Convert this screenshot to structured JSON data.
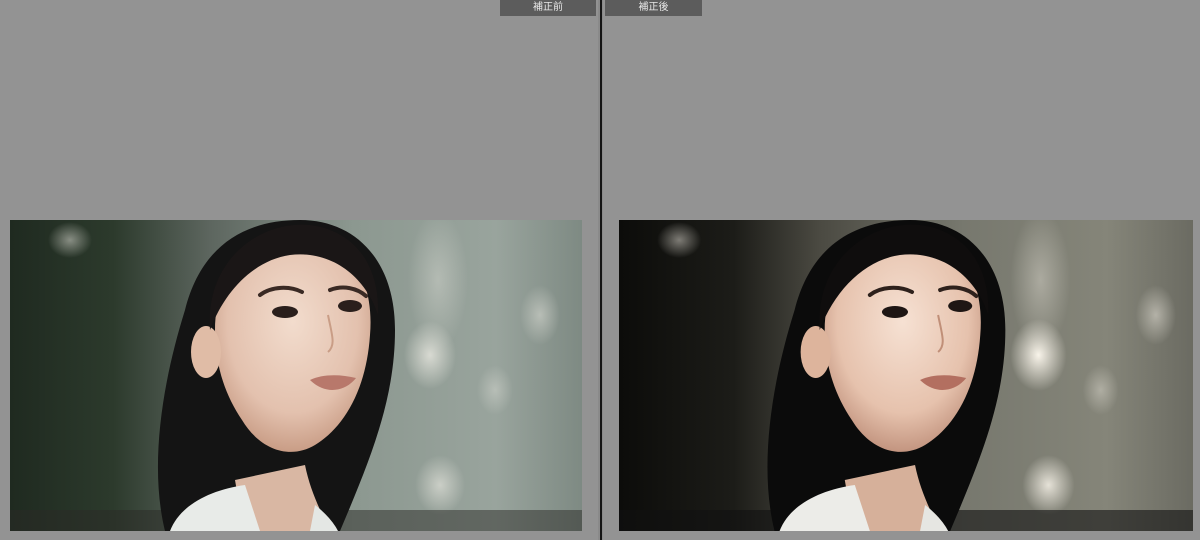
{
  "viewer": {
    "before_label": "補正前",
    "after_label": "補正後"
  },
  "photos": {
    "before": {
      "subject": "portrait-woman",
      "tone": "original"
    },
    "after": {
      "subject": "portrait-woman",
      "tone": "corrected"
    }
  },
  "colors": {
    "background": "#929292",
    "label_bg": "#5c5c5c",
    "label_text": "#e8e8e8",
    "divider": "#141414"
  }
}
